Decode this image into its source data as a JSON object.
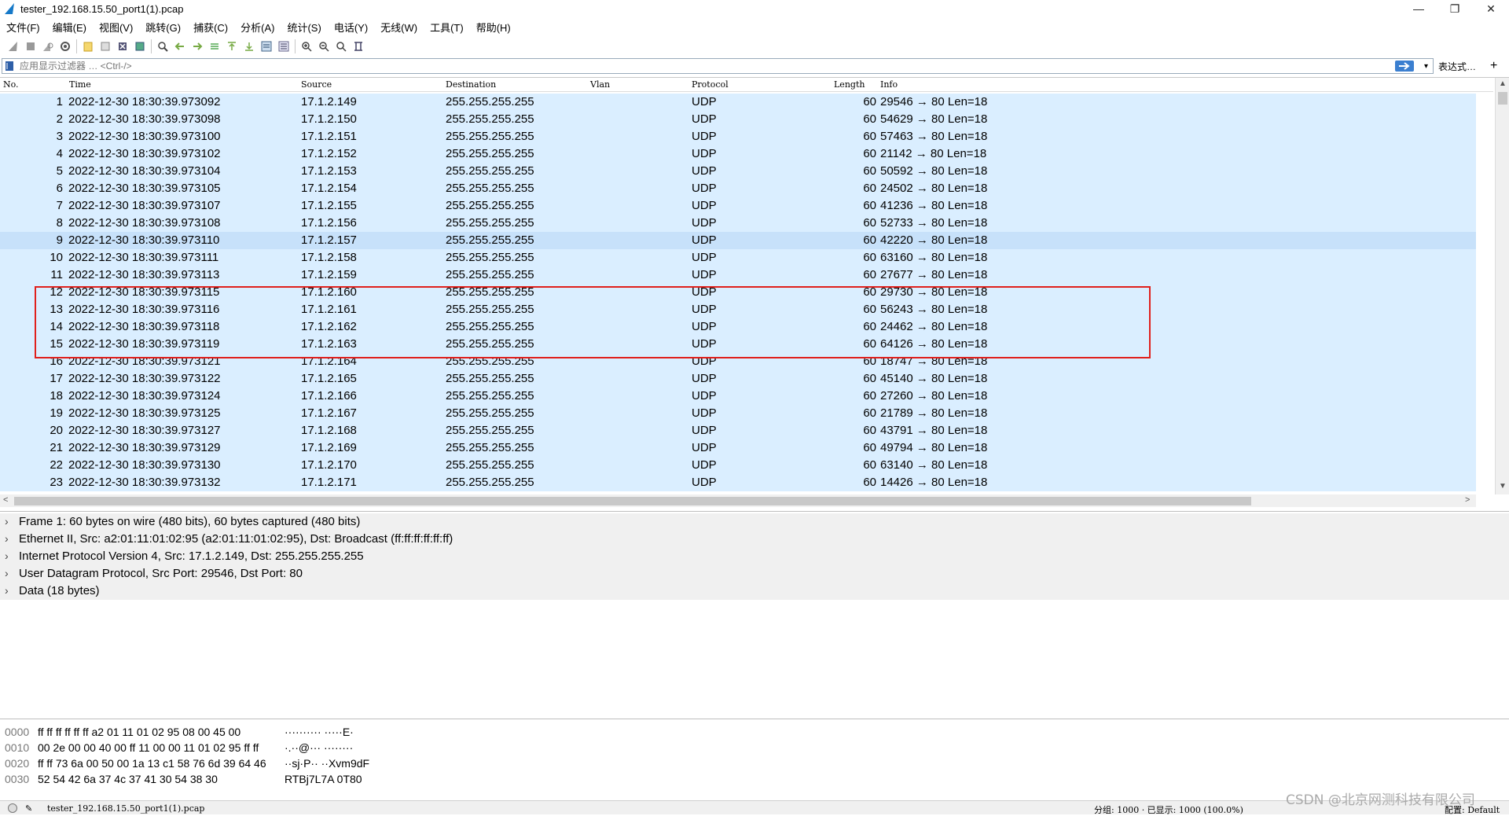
{
  "window": {
    "title": "tester_192.168.15.50_port1(1).pcap",
    "buttons": [
      "—",
      "❐",
      "✕"
    ]
  },
  "menu": [
    "文件(F)",
    "编辑(E)",
    "视图(V)",
    "跳转(G)",
    "捕获(C)",
    "分析(A)",
    "统计(S)",
    "电话(Y)",
    "无线(W)",
    "工具(T)",
    "帮助(H)"
  ],
  "filter": {
    "placeholder": "应用显示过滤器 … <Ctrl-/>",
    "expression_label": "表达式…",
    "plus": "+"
  },
  "packet_list": {
    "headers": {
      "no": "No.",
      "time": "Time",
      "source": "Source",
      "destination": "Destination",
      "vlan": "Vlan",
      "protocol": "Protocol",
      "length": "Length",
      "info": "Info"
    },
    "rows": [
      {
        "no": "1",
        "time": "2022-12-30 18:30:39.973092",
        "source": "17.1.2.149",
        "destination": "255.255.255.255",
        "protocol": "UDP",
        "length": "60",
        "info": "29546 → 80 Len=18"
      },
      {
        "no": "2",
        "time": "2022-12-30 18:30:39.973098",
        "source": "17.1.2.150",
        "destination": "255.255.255.255",
        "protocol": "UDP",
        "length": "60",
        "info": "54629 → 80 Len=18"
      },
      {
        "no": "3",
        "time": "2022-12-30 18:30:39.973100",
        "source": "17.1.2.151",
        "destination": "255.255.255.255",
        "protocol": "UDP",
        "length": "60",
        "info": "57463 → 80 Len=18"
      },
      {
        "no": "4",
        "time": "2022-12-30 18:30:39.973102",
        "source": "17.1.2.152",
        "destination": "255.255.255.255",
        "protocol": "UDP",
        "length": "60",
        "info": "21142 → 80 Len=18"
      },
      {
        "no": "5",
        "time": "2022-12-30 18:30:39.973104",
        "source": "17.1.2.153",
        "destination": "255.255.255.255",
        "protocol": "UDP",
        "length": "60",
        "info": "50592 → 80 Len=18"
      },
      {
        "no": "6",
        "time": "2022-12-30 18:30:39.973105",
        "source": "17.1.2.154",
        "destination": "255.255.255.255",
        "protocol": "UDP",
        "length": "60",
        "info": "24502 → 80 Len=18"
      },
      {
        "no": "7",
        "time": "2022-12-30 18:30:39.973107",
        "source": "17.1.2.155",
        "destination": "255.255.255.255",
        "protocol": "UDP",
        "length": "60",
        "info": "41236 → 80 Len=18"
      },
      {
        "no": "8",
        "time": "2022-12-30 18:30:39.973108",
        "source": "17.1.2.156",
        "destination": "255.255.255.255",
        "protocol": "UDP",
        "length": "60",
        "info": "52733 → 80 Len=18"
      },
      {
        "no": "9",
        "time": "2022-12-30 18:30:39.973110",
        "source": "17.1.2.157",
        "destination": "255.255.255.255",
        "protocol": "UDP",
        "length": "60",
        "info": "42220 → 80 Len=18"
      },
      {
        "no": "10",
        "time": "2022-12-30 18:30:39.973111",
        "source": "17.1.2.158",
        "destination": "255.255.255.255",
        "protocol": "UDP",
        "length": "60",
        "info": "63160 → 80 Len=18"
      },
      {
        "no": "11",
        "time": "2022-12-30 18:30:39.973113",
        "source": "17.1.2.159",
        "destination": "255.255.255.255",
        "protocol": "UDP",
        "length": "60",
        "info": "27677 → 80 Len=18"
      },
      {
        "no": "12",
        "time": "2022-12-30 18:30:39.973115",
        "source": "17.1.2.160",
        "destination": "255.255.255.255",
        "protocol": "UDP",
        "length": "60",
        "info": "29730 → 80 Len=18"
      },
      {
        "no": "13",
        "time": "2022-12-30 18:30:39.973116",
        "source": "17.1.2.161",
        "destination": "255.255.255.255",
        "protocol": "UDP",
        "length": "60",
        "info": "56243 → 80 Len=18"
      },
      {
        "no": "14",
        "time": "2022-12-30 18:30:39.973118",
        "source": "17.1.2.162",
        "destination": "255.255.255.255",
        "protocol": "UDP",
        "length": "60",
        "info": "24462 → 80 Len=18"
      },
      {
        "no": "15",
        "time": "2022-12-30 18:30:39.973119",
        "source": "17.1.2.163",
        "destination": "255.255.255.255",
        "protocol": "UDP",
        "length": "60",
        "info": "64126 → 80 Len=18"
      },
      {
        "no": "16",
        "time": "2022-12-30 18:30:39.973121",
        "source": "17.1.2.164",
        "destination": "255.255.255.255",
        "protocol": "UDP",
        "length": "60",
        "info": "18747 → 80 Len=18"
      },
      {
        "no": "17",
        "time": "2022-12-30 18:30:39.973122",
        "source": "17.1.2.165",
        "destination": "255.255.255.255",
        "protocol": "UDP",
        "length": "60",
        "info": "45140 → 80 Len=18"
      },
      {
        "no": "18",
        "time": "2022-12-30 18:30:39.973124",
        "source": "17.1.2.166",
        "destination": "255.255.255.255",
        "protocol": "UDP",
        "length": "60",
        "info": "27260 → 80 Len=18"
      },
      {
        "no": "19",
        "time": "2022-12-30 18:30:39.973125",
        "source": "17.1.2.167",
        "destination": "255.255.255.255",
        "protocol": "UDP",
        "length": "60",
        "info": "21789 → 80 Len=18"
      },
      {
        "no": "20",
        "time": "2022-12-30 18:30:39.973127",
        "source": "17.1.2.168",
        "destination": "255.255.255.255",
        "protocol": "UDP",
        "length": "60",
        "info": "43791 → 80 Len=18"
      },
      {
        "no": "21",
        "time": "2022-12-30 18:30:39.973129",
        "source": "17.1.2.169",
        "destination": "255.255.255.255",
        "protocol": "UDP",
        "length": "60",
        "info": "49794 → 80 Len=18"
      },
      {
        "no": "22",
        "time": "2022-12-30 18:30:39.973130",
        "source": "17.1.2.170",
        "destination": "255.255.255.255",
        "protocol": "UDP",
        "length": "60",
        "info": "63140 → 80 Len=18"
      },
      {
        "no": "23",
        "time": "2022-12-30 18:30:39.973132",
        "source": "17.1.2.171",
        "destination": "255.255.255.255",
        "protocol": "UDP",
        "length": "60",
        "info": "14426 → 80 Len=18"
      }
    ]
  },
  "details": [
    "Frame 1: 60 bytes on wire (480 bits), 60 bytes captured (480 bits)",
    "Ethernet II, Src: a2:01:11:01:02:95 (a2:01:11:01:02:95), Dst: Broadcast (ff:ff:ff:ff:ff:ff)",
    "Internet Protocol Version 4, Src: 17.1.2.149, Dst: 255.255.255.255",
    "User Datagram Protocol, Src Port: 29546, Dst Port: 80",
    "Data (18 bytes)"
  ],
  "bytes": [
    {
      "offset": "0000",
      "hex": "ff ff ff ff ff ff a2 01  11 01 02 95 08 00 45 00",
      "ascii": "·········· ·····E·"
    },
    {
      "offset": "0010",
      "hex": "00 2e 00 00 40 00 ff 11  00 00 11 01 02 95 ff ff",
      "ascii": "·.··@··· ········"
    },
    {
      "offset": "0020",
      "hex": "ff ff 73 6a 00 50 00 1a  13 c1 58 76 6d 39 64 46",
      "ascii": "··sj·P·· ··Xvm9dF"
    },
    {
      "offset": "0030",
      "hex": "52 54 42 6a 37 4c 37 41  30 54 38 30",
      "ascii": "RTBj7L7A 0T80"
    }
  ],
  "status": {
    "file": "tester_192.168.15.50_port1(1).pcap",
    "packets": "分组: 1000 · 已显示: 1000 (100.0%)",
    "profile": "配置: Default"
  },
  "watermark": "CSDN @北京网测科技有限公司",
  "colors": {
    "row_bg": "#daeeff",
    "row_selected": "#c7e1fa",
    "highlight": "#e0201c"
  }
}
